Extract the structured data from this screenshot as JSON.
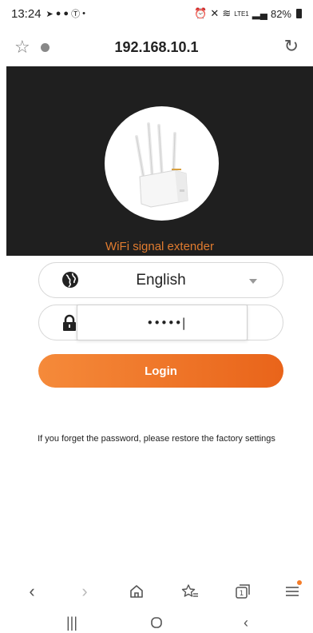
{
  "status_bar": {
    "time": "13:24",
    "battery_text": "82%",
    "network_text": "LTE1",
    "left_icons": [
      "send-icon",
      "chat-icon",
      "messenger-icon",
      "t-icon",
      "dot-icon"
    ],
    "right_icons": [
      "alarm-icon",
      "mute-icon",
      "wifi-icon",
      "signal-icon",
      "battery-icon"
    ]
  },
  "browser": {
    "url": "192.168.10.1",
    "icons": {
      "bookmark": "star-outline-icon",
      "info": "info-icon",
      "reload": "reload-icon"
    }
  },
  "hero": {
    "tagline": "WiFi signal extender",
    "tagline_color": "#e07b2f",
    "background_color": "#1f1f1f"
  },
  "form": {
    "language": {
      "selected": "English",
      "icon": "globe-icon"
    },
    "password": {
      "value": "•••••|",
      "icon": "lock-icon"
    },
    "login_label": "Login",
    "accent_color": "#ee6f22"
  },
  "hint_text": "If you forget the password, please restore the factory settings",
  "toolbar": {
    "tab_count": "1",
    "items": [
      "back-icon",
      "forward-icon",
      "home-icon",
      "bookmarks-icon",
      "tabs-icon",
      "menu-icon"
    ]
  },
  "system_nav": {
    "items": [
      "recents-icon",
      "home-circle-icon",
      "back-icon"
    ]
  }
}
